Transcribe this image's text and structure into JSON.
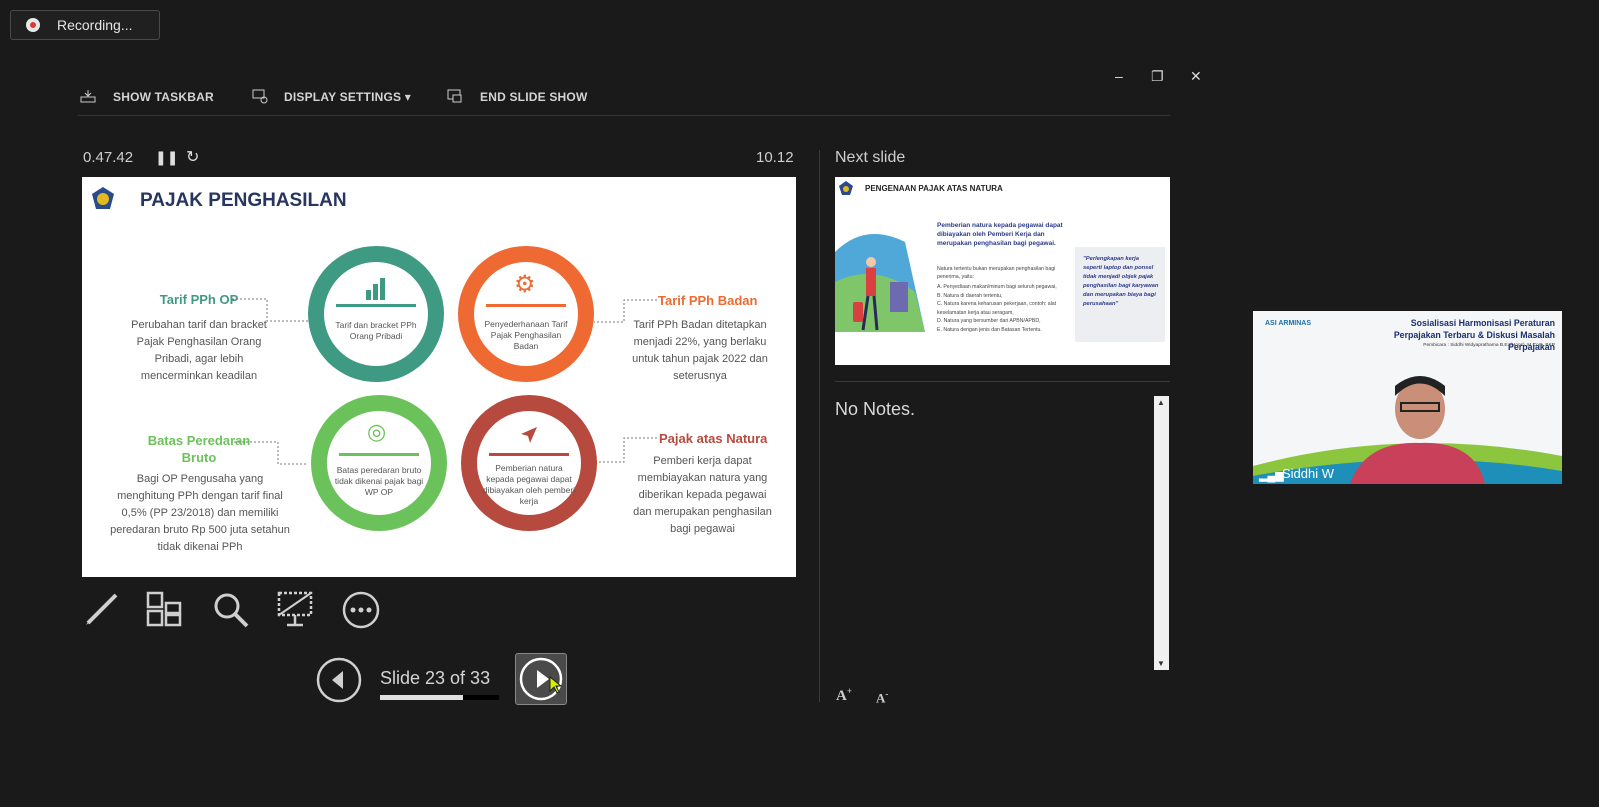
{
  "recording": {
    "label": "Recording..."
  },
  "toolbar": {
    "show_taskbar": "SHOW TASKBAR",
    "display_settings": "DISPLAY SETTINGS ▾",
    "end_show": "END SLIDE SHOW"
  },
  "window_controls": {
    "minimize": "–",
    "restore": "❐",
    "close": "✕"
  },
  "presenter": {
    "elapsed": "0.47.42",
    "clock": "10.12",
    "next_slide_label": "Next slide",
    "notes": "No Notes.",
    "slide_counter": "Slide 23 of 33",
    "progress": 0.7
  },
  "slide": {
    "title": "PAJAK PENGHASILAN",
    "tarif_op": {
      "heading": "Tarif PPh OP",
      "body": "Perubahan tarif dan bracket Pajak Penghasilan Orang Pribadi, agar lebih mencerminkan keadilan",
      "ring": "Tarif dan bracket PPh Orang Pribadi"
    },
    "tarif_badan": {
      "heading": "Tarif PPh Badan",
      "body": "Tarif PPh Badan ditetapkan menjadi 22%, yang berlaku untuk tahun pajak 2022 dan seterusnya",
      "ring": "Penyederhanaan Tarif Pajak Penghasilan Badan"
    },
    "batas": {
      "heading": "Batas Peredaran Bruto",
      "body": "Bagi OP Pengusaha yang menghitung PPh dengan tarif final 0,5% (PP 23/2018) dan memiliki peredaran bruto Rp 500 juta setahun tidak dikenai PPh",
      "ring": "Batas peredaran bruto tidak dikenai pajak bagi WP OP"
    },
    "natura": {
      "heading": "Pajak atas Natura",
      "body": "Pemberi kerja dapat membiayakan natura yang diberikan kepada pegawai dan merupakan penghasilan bagi pegawai",
      "ring": "Pemberian natura kepada pegawai dapat dibiayakan oleh pemberi kerja"
    }
  },
  "next_slide": {
    "title": "PENGENAAN PAJAK ATAS NATURA",
    "lead": "Pemberian natura kepada pegawai dapat dibiayakan oleh Pemberi Kerja dan merupakan penghasilan bagi pegawai.",
    "intro": "Natura tertentu bukan merupakan penghasilan bagi penerima, yaitu:",
    "items": [
      "A. Penyediaan makan/minum bagi seluruh pegawai,",
      "B. Natura di daerah tertentu,",
      "C. Natura karena keharusan pekerjaan, contoh: alat keselamatan kerja atau seragam,",
      "D. Natura yang bersumber dari APBN/APBD,",
      "E. Natura dengan jenis dan Batasan Tertentu."
    ],
    "quote": "\"Perlengkapan kerja seperti laptop dan ponsel tidak menjadi objek pajak penghasilan bagi karyawan dan merupakan biaya bagi perusahaan\""
  },
  "video": {
    "participant": "Siddhi W",
    "banner_title": "Sosialisasi Harmonisasi Peraturan Perpajakan Terbaru & Diskusi Masalah Perpajakan",
    "banner_sub": "Pembicara : Siddhi Widyaprathama B.E. (Hons), M.Com, BKP",
    "logo": "ASI ARMINAS"
  },
  "colors": {
    "teal": "#3f9a84",
    "orange": "#ee6a32",
    "green": "#6cc25a",
    "red": "#b64a3e",
    "navy": "#1e2a52"
  }
}
